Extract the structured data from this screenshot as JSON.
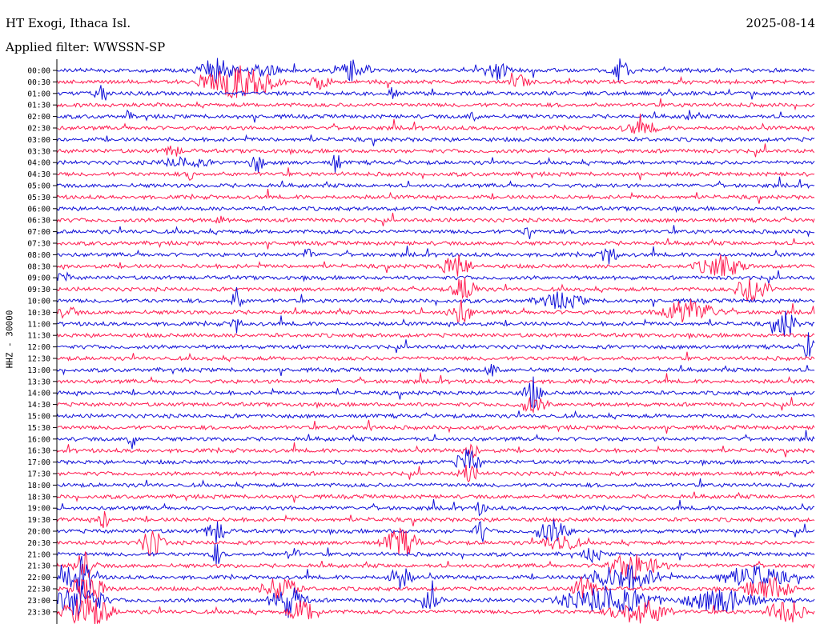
{
  "header": {
    "station": "HT Exogi, Ithaca Isl.",
    "filter": "Applied filter: WWSSN-SP",
    "date": "2025-08-14"
  },
  "chart_data": {
    "type": "line",
    "title": "HT Exogi, Ithaca Isl.",
    "subtitle": "Applied filter: WWSSN-SP",
    "date": "2025-08-14",
    "ylabel": "HHZ - 30000",
    "y_tick_labels": [
      "00:00",
      "00:30",
      "01:00",
      "01:30",
      "02:00",
      "02:30",
      "03:00",
      "03:30",
      "04:00",
      "04:30",
      "05:00",
      "05:30",
      "06:00",
      "06:30",
      "07:00",
      "07:30",
      "08:00",
      "08:30",
      "09:00",
      "09:30",
      "10:00",
      "10:30",
      "11:00",
      "11:30",
      "12:00",
      "12:30",
      "13:00",
      "13:30",
      "14:00",
      "14:30",
      "15:00",
      "15:30",
      "16:00",
      "16:30",
      "17:00",
      "17:30",
      "18:00",
      "18:30",
      "19:00",
      "19:30",
      "20:00",
      "20:30",
      "21:00",
      "21:30",
      "22:00",
      "22:30",
      "23:00",
      "23:30"
    ],
    "series_colors": [
      "#1010d8",
      "#ff1a4f"
    ],
    "color_pattern": "alternating per 30-minute trace line",
    "grid": false
  }
}
